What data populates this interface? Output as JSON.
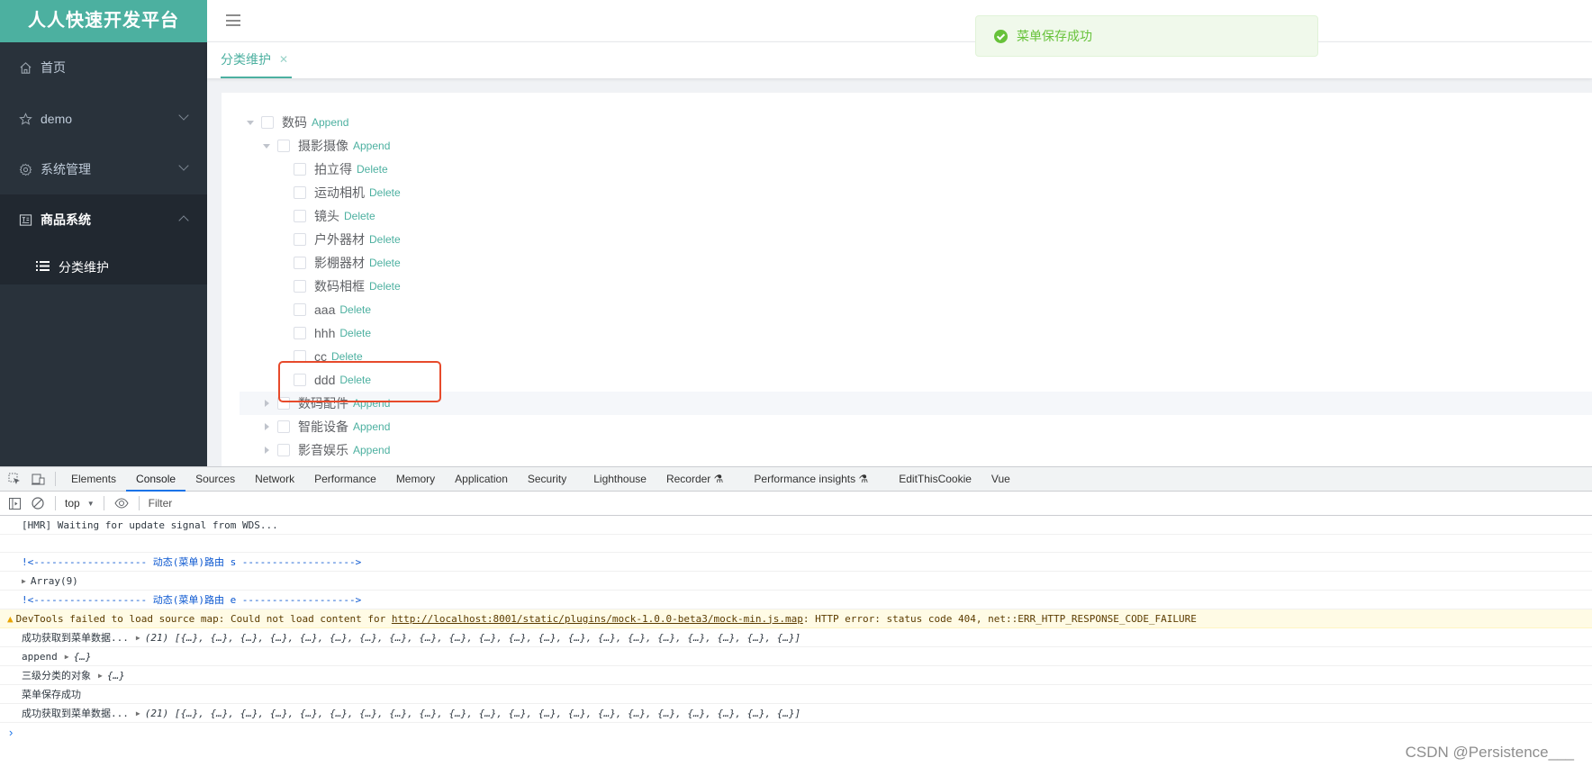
{
  "sidebar": {
    "logo": "人人快速开发平台",
    "items": [
      {
        "label": "首页",
        "icon": "home-icon"
      },
      {
        "label": "demo",
        "icon": "star-icon",
        "expandable": true
      },
      {
        "label": "系统管理",
        "icon": "gear-icon",
        "expandable": true
      },
      {
        "label": "商品系统",
        "icon": "product-icon",
        "expandable": true,
        "expanded": true
      }
    ],
    "submenu": [
      {
        "label": "分类维护",
        "icon": "list-icon",
        "active": true
      }
    ]
  },
  "tabs": [
    {
      "label": "分类维护",
      "closable": true,
      "active": true
    }
  ],
  "toast": {
    "type": "success",
    "message": "菜单保存成功",
    "color": "#67c23a"
  },
  "tree": {
    "accent_color": "#4cb0a0",
    "nodes": [
      {
        "label": "数码",
        "level": 1,
        "expanded": true,
        "action": "Append"
      },
      {
        "label": "摄影摄像",
        "level": 2,
        "expanded": true,
        "action": "Append"
      },
      {
        "label": "拍立得",
        "level": 3,
        "action": "Delete"
      },
      {
        "label": "运动相机",
        "level": 3,
        "action": "Delete"
      },
      {
        "label": "镜头",
        "level": 3,
        "action": "Delete"
      },
      {
        "label": "户外器材",
        "level": 3,
        "action": "Delete"
      },
      {
        "label": "影棚器材",
        "level": 3,
        "action": "Delete"
      },
      {
        "label": "数码相框",
        "level": 3,
        "action": "Delete"
      },
      {
        "label": "aaa",
        "level": 3,
        "action": "Delete"
      },
      {
        "label": "hhh",
        "level": 3,
        "action": "Delete"
      },
      {
        "label": "cc",
        "level": 3,
        "action": "Delete"
      },
      {
        "label": "ddd",
        "level": 3,
        "action": "Delete",
        "annotated": true
      },
      {
        "label": "数码配件",
        "level": 2,
        "expanded": false,
        "action": "Append",
        "hovered": true
      },
      {
        "label": "智能设备",
        "level": 2,
        "expanded": false,
        "action": "Append"
      },
      {
        "label": "影音娱乐",
        "level": 2,
        "expanded": false,
        "action": "Append"
      }
    ]
  },
  "devtools": {
    "tabs": [
      "Elements",
      "Console",
      "Sources",
      "Network",
      "Performance",
      "Memory",
      "Application",
      "Security",
      "Lighthouse",
      "Recorder ⚗",
      "Performance insights ⚗",
      "EditThisCookie",
      "Vue"
    ],
    "active_tab": "Console",
    "context": "top",
    "filter_placeholder": "Filter",
    "console": {
      "hmr": "[HMR] Waiting for update signal from WDS...",
      "route_start": "!<------------------- 动态(菜单)路由 s ------------------->",
      "array_label": "Array(9)",
      "route_end": "!<------------------- 动态(菜单)路由 e ------------------->",
      "warn_prefix": "DevTools failed to load source map: Could not load content for ",
      "warn_url": "http://localhost:8001/static/plugins/mock-1.0.0-beta3/mock-min.js.map",
      "warn_suffix": ": HTTP error: status code 404, net::ERR_HTTP_RESPONSE_CODE_FAILURE",
      "fetch1_label": "成功获取到菜单数据...",
      "fetch_value": "(21) [{…}, {…}, {…}, {…}, {…}, {…}, {…}, {…}, {…}, {…}, {…}, {…}, {…}, {…}, {…}, {…}, {…}, {…}, {…}, {…}, {…}]",
      "append_label": "append",
      "obj_value": "{…}",
      "third_label": "三级分类的对象",
      "saved": "菜单保存成功",
      "fetch2_label": "成功获取到菜单数据...",
      "prompt": "›"
    }
  },
  "watermark": "CSDN @Persistence___"
}
